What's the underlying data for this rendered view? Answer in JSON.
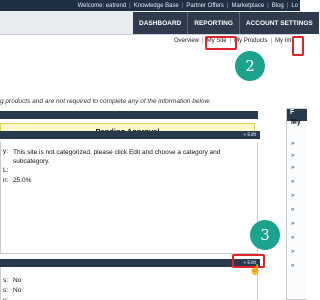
{
  "topbar": {
    "links": [
      "Welcome: eatrend",
      "Knowledge Base",
      "Partner Offers",
      "Marketplace",
      "Blog",
      "Lo"
    ]
  },
  "navbar": {
    "tabs": [
      "DASHBOARD",
      "REPORTING",
      "ACCOUNT SETTINGS"
    ]
  },
  "subnav": {
    "links": [
      "Overview",
      "My Site",
      "My Products",
      "My Im"
    ]
  },
  "intro_text": "g products and are not required to complete any of the information below.",
  "status": {
    "pending_label": "Pending Approval"
  },
  "section_edit_label": "» Edit",
  "details": {
    "rows": [
      {
        "label": "y:",
        "value": "This site is not categorized, please click Edit and choose a category and subcategory."
      },
      {
        "label": "L:",
        "value": ""
      },
      {
        "label": "n:",
        "value": "25.0%"
      }
    ]
  },
  "details2": {
    "rows": [
      {
        "label": "s:",
        "value": "No"
      },
      {
        "label": "s:",
        "value": "No"
      },
      {
        "label": "y:",
        "value": ""
      },
      {
        "label": "y:",
        "value": ""
      }
    ]
  },
  "callouts": {
    "step2": "2",
    "step3": "3"
  },
  "sidebar": {
    "title": "My"
  },
  "colors": {
    "accent_callout": "#1ba38d",
    "highlight_red": "#e0242b",
    "header_dark": "#1f2f44",
    "pending_bg": "#fff9c8"
  }
}
